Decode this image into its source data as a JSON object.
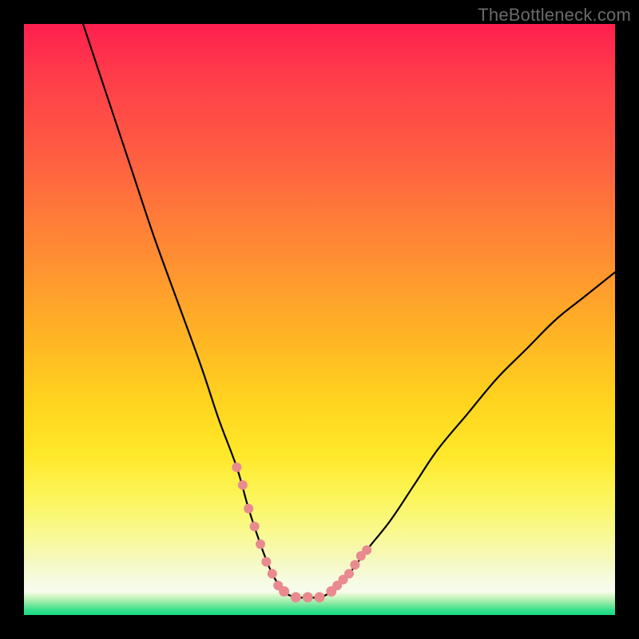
{
  "watermark": "TheBottleneck.com",
  "chart_data": {
    "type": "line",
    "title": "",
    "xlabel": "",
    "ylabel": "",
    "xlim": [
      0,
      100
    ],
    "ylim": [
      0,
      100
    ],
    "grid": false,
    "legend": false,
    "notes": "V-shaped bottleneck curve over red→yellow→green vertical gradient. Minimum (optimal zone) near x≈42–52 at y≈3. Left branch starts near top-left (x≈10, y≈100) and descends steeply; right branch rises from the minimum and exits at the right edge near y≈58. Pink dotted segments mark the near-bottom portion of each branch and the flat bottom.",
    "series": [
      {
        "name": "bottleneck-curve",
        "x": [
          10,
          14,
          18,
          22,
          26,
          30,
          33,
          36,
          38,
          40,
          42,
          44,
          46,
          48,
          50,
          52,
          55,
          58,
          62,
          66,
          70,
          75,
          80,
          85,
          90,
          95,
          100
        ],
        "y": [
          100,
          88,
          76,
          64,
          53,
          42,
          33,
          25,
          18,
          12,
          7,
          4,
          3,
          3,
          3,
          4,
          7,
          11,
          16,
          22,
          28,
          34,
          40,
          45,
          50,
          54,
          58
        ]
      }
    ],
    "optimal_zone": {
      "x_start": 42,
      "x_end": 52,
      "y": 3
    },
    "dot_markers": {
      "left_branch": [
        [
          36,
          25
        ],
        [
          37,
          22
        ],
        [
          38,
          18
        ],
        [
          39,
          15
        ],
        [
          40,
          12
        ],
        [
          41,
          9
        ],
        [
          42,
          7
        ],
        [
          43,
          5
        ]
      ],
      "bottom": [
        [
          44,
          4
        ],
        [
          46,
          3
        ],
        [
          48,
          3
        ],
        [
          50,
          3
        ],
        [
          52,
          4
        ]
      ],
      "right_branch": [
        [
          53,
          5
        ],
        [
          54,
          6
        ],
        [
          55,
          7
        ],
        [
          56,
          8.5
        ],
        [
          57,
          10
        ],
        [
          58,
          11
        ]
      ]
    },
    "background_gradient_stops": [
      {
        "pos": 0,
        "color": "#ff1f4f"
      },
      {
        "pos": 22,
        "color": "#ff5d42"
      },
      {
        "pos": 52,
        "color": "#ffb225"
      },
      {
        "pos": 73,
        "color": "#ffe82a"
      },
      {
        "pos": 91,
        "color": "#f6f9c2"
      },
      {
        "pos": 97,
        "color": "#f0fbe4"
      },
      {
        "pos": 100,
        "color": "#1cd983"
      }
    ]
  }
}
